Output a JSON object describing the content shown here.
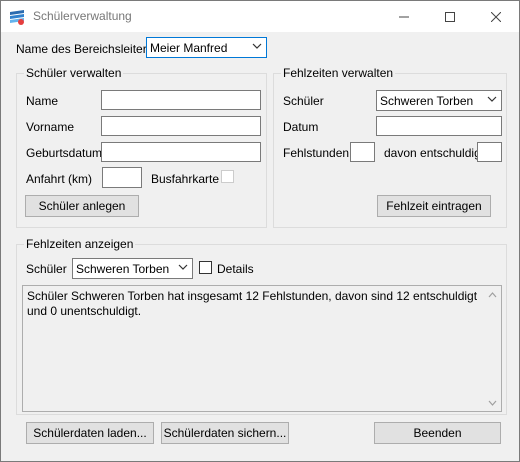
{
  "window": {
    "title": "Schülerverwaltung",
    "minimize": "—",
    "maximize": "☐",
    "close": "✕"
  },
  "header": {
    "label": "Name des Bereichsleiters",
    "value": "Meier Manfred"
  },
  "students": {
    "title": "Schüler verwalten",
    "name_label": "Name",
    "name_value": "",
    "firstname_label": "Vorname",
    "firstname_value": "",
    "birthdate_label": "Geburtsdatum",
    "birthdate_value": "",
    "distance_label": "Anfahrt (km)",
    "distance_value": "",
    "bus_label": "Busfahrkarte",
    "bus_checked": false,
    "create_button": "Schüler anlegen"
  },
  "absences": {
    "title": "Fehlzeiten verwalten",
    "student_label": "Schüler",
    "student_value": "Schweren Torben",
    "date_label": "Datum",
    "date_value": "",
    "hours_label": "Fehlstunden",
    "hours_value": "",
    "excused_label": "davon entschuldigt",
    "excused_value": "",
    "enter_button": "Fehlzeit eintragen"
  },
  "show": {
    "title": "Fehlzeiten anzeigen",
    "student_label": "Schüler",
    "student_value": "Schweren Torben",
    "details_label": "Details",
    "details_checked": false,
    "output": "Schüler Schweren Torben hat insgesamt 12 Fehlstunden, davon sind 12 entschuldigt und 0 unentschuldigt."
  },
  "footer": {
    "load_button": "Schülerdaten laden...",
    "save_button": "Schülerdaten sichern...",
    "exit_button": "Beenden"
  }
}
